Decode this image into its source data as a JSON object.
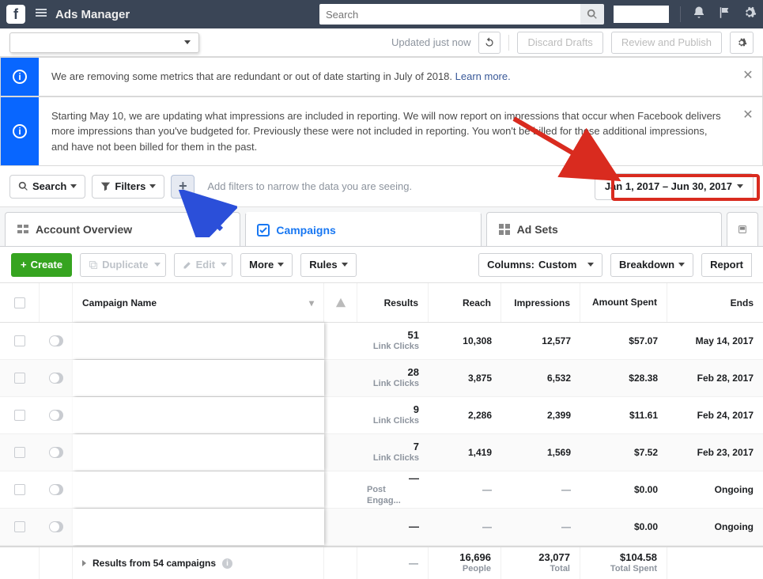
{
  "topbar": {
    "title": "Ads Manager",
    "search_placeholder": "Search"
  },
  "subbar": {
    "updated": "Updated just now",
    "discard": "Discard Drafts",
    "review": "Review and Publish"
  },
  "banners": [
    {
      "text": "We are removing some metrics that are redundant or out of date starting in July of 2018. ",
      "link": "Learn more."
    },
    {
      "text": "Starting May 10, we are updating what impressions are included in reporting. We will now report on impressions that occur when Facebook delivers more impressions than you've budgeted for. Previously these were not included in reporting. You won't be billed for these additional impressions, and have not been billed for them in the past."
    }
  ],
  "filterbar": {
    "search": "Search",
    "filters": "Filters",
    "hint": "Add filters to narrow the data you are seeing.",
    "date": "Jan 1, 2017 – Jun 30, 2017"
  },
  "tabs": {
    "overview": "Account Overview",
    "campaigns": "Campaigns",
    "adsets": "Ad Sets"
  },
  "toolbar": {
    "create": "Create",
    "duplicate": "Duplicate",
    "edit": "Edit",
    "more": "More",
    "rules": "Rules",
    "columns_pre": "Columns: ",
    "columns_val": "Custom",
    "breakdown": "Breakdown",
    "report": "Report"
  },
  "columns": {
    "name": "Campaign Name",
    "results": "Results",
    "reach": "Reach",
    "impressions": "Impressions",
    "amount": "Amount Spent",
    "ends": "Ends"
  },
  "rows": [
    {
      "results": "51",
      "rsub": "Link Clicks",
      "reach": "10,308",
      "imp": "12,577",
      "amt": "$57.07",
      "ends": "May 14, 2017"
    },
    {
      "results": "28",
      "rsub": "Link Clicks",
      "reach": "3,875",
      "imp": "6,532",
      "amt": "$28.38",
      "ends": "Feb 28, 2017"
    },
    {
      "results": "9",
      "rsub": "Link Clicks",
      "reach": "2,286",
      "imp": "2,399",
      "amt": "$11.61",
      "ends": "Feb 24, 2017"
    },
    {
      "results": "7",
      "rsub": "Link Clicks",
      "reach": "1,419",
      "imp": "1,569",
      "amt": "$7.52",
      "ends": "Feb 23, 2017"
    },
    {
      "results": "—",
      "rsub": "Post Engag...",
      "reach": "—",
      "imp": "—",
      "amt": "$0.00",
      "ends": "Ongoing"
    },
    {
      "results": "—",
      "rsub": "",
      "reach": "—",
      "imp": "—",
      "amt": "$0.00",
      "ends": "Ongoing"
    }
  ],
  "footer": {
    "label": "Results from 54 campaigns",
    "results": "—",
    "reach": "16,696",
    "reach_sub": "People",
    "imp": "23,077",
    "imp_sub": "Total",
    "amt": "$104.58",
    "amt_sub": "Total Spent"
  }
}
